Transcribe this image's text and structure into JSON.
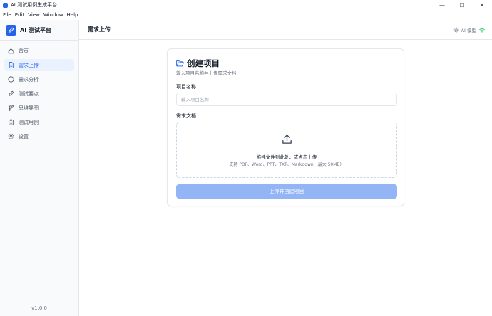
{
  "window": {
    "title": "AI 测试用例生成平台",
    "controls": {
      "minimize": "—",
      "maximize": "☐",
      "close": "✕"
    }
  },
  "menu": [
    "File",
    "Edit",
    "View",
    "Window",
    "Help"
  ],
  "sidebar": {
    "brand": "AI 测试平台",
    "items": [
      {
        "label": "首页",
        "icon": "home-icon"
      },
      {
        "label": "需求上传",
        "icon": "document-icon",
        "active": true
      },
      {
        "label": "需求分析",
        "icon": "info-circle-icon"
      },
      {
        "label": "测试要点",
        "icon": "pencil-icon"
      },
      {
        "label": "思维导图",
        "icon": "branch-icon"
      },
      {
        "label": "测试用例",
        "icon": "clipboard-icon"
      },
      {
        "label": "设置",
        "icon": "gear-icon"
      }
    ],
    "version": "v1.0.0"
  },
  "topbar": {
    "title": "需求上传",
    "model_label": "AI 模型"
  },
  "form": {
    "title": "创建项目",
    "subtitle": "输入项目名称并上传需求文档",
    "name_label": "项目名称",
    "name_placeholder": "输入项目名称",
    "name_value": "",
    "doc_label": "需求文档",
    "drop_text": "拖拽文件到此处，或点击上传",
    "drop_hint": "支持 PDF、Word、PPT、TXT、Markdown（最大 50MB）",
    "submit_label": "上传并创建项目"
  },
  "colors": {
    "accent": "#2563eb",
    "active_bg": "#eaf2ff",
    "button_disabled": "#93b4f5",
    "status_green": "#22c55e"
  }
}
